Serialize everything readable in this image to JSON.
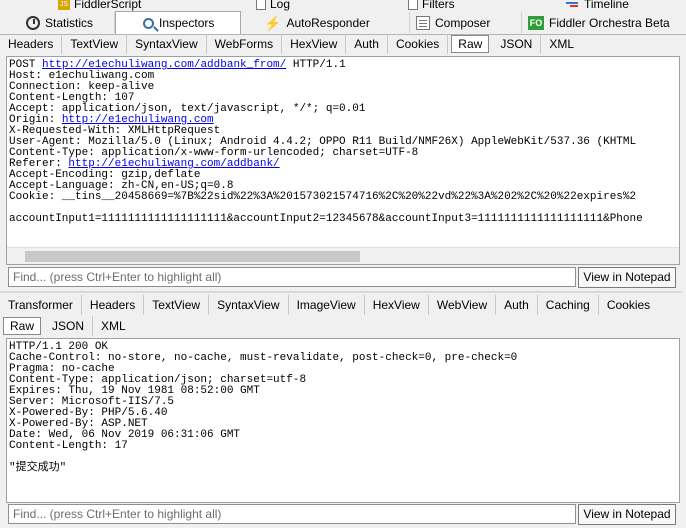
{
  "top_tabs_row1": [
    "FiddlerScript",
    "Log",
    "Filters",
    "Timeline"
  ],
  "top_tabs_row2": [
    "Statistics",
    "Inspectors",
    "AutoResponder",
    "Composer",
    "Fiddler Orchestra Beta"
  ],
  "fo_badge": "FO",
  "request_tabs": [
    "Headers",
    "TextView",
    "SyntaxView",
    "WebForms",
    "HexView",
    "Auth",
    "Cookies",
    "Raw",
    "JSON",
    "XML"
  ],
  "request_active_tab": "Raw",
  "request_lines": [
    {
      "pre": "POST ",
      "link": "http://e1echuliwang.com/addbank_from/",
      "post": " HTTP/1.1"
    },
    {
      "pre": "Host: e1echuliwang.com"
    },
    {
      "pre": "Connection: keep-alive"
    },
    {
      "pre": "Content-Length: 107"
    },
    {
      "pre": "Accept: application/json, text/javascript, */*; q=0.01"
    },
    {
      "pre": "Origin: ",
      "link": "http://e1echuliwang.com"
    },
    {
      "pre": "X-Requested-With: XMLHttpRequest"
    },
    {
      "pre": "User-Agent: Mozilla/5.0 (Linux; Android 4.4.2; OPPO R11 Build/NMF26X) AppleWebKit/537.36 (KHTML"
    },
    {
      "pre": "Content-Type: application/x-www-form-urlencoded; charset=UTF-8"
    },
    {
      "pre": "Referer: ",
      "link": "http://e1echuliwang.com/addbank/"
    },
    {
      "pre": "Accept-Encoding: gzip,deflate"
    },
    {
      "pre": "Accept-Language: zh-CN,en-US;q=0.8"
    },
    {
      "pre": "Cookie: __tins__20458669=%7B%22sid%22%3A%201573021574716%2C%20%22vd%22%3A%202%2C%20%22expires%2"
    },
    {
      "pre": ""
    },
    {
      "pre": "accountInput1=1111111111111111111&accountInput2=12345678&accountInput3=1111111111111111111&Phone"
    }
  ],
  "find_placeholder": "Find... (press Ctrl+Enter to highlight all)",
  "view_notepad_label": "View in Notepad",
  "response_tabs_row1": [
    "Transformer",
    "Headers",
    "TextView",
    "SyntaxView",
    "ImageView",
    "HexView",
    "WebView",
    "Auth",
    "Caching",
    "Cookies"
  ],
  "response_tabs_row2": [
    "Raw",
    "JSON",
    "XML"
  ],
  "response_active_tab": "Raw",
  "response_lines": [
    "HTTP/1.1 200 OK",
    "Cache-Control: no-store, no-cache, must-revalidate, post-check=0, pre-check=0",
    "Pragma: no-cache",
    "Content-Type: application/json; charset=utf-8",
    "Expires: Thu, 19 Nov 1981 08:52:00 GMT",
    "Server: Microsoft-IIS/7.5",
    "X-Powered-By: PHP/5.6.40",
    "X-Powered-By: ASP.NET",
    "Date: Wed, 06 Nov 2019 06:31:06 GMT",
    "Content-Length: 17",
    "",
    "\"提交成功\""
  ]
}
